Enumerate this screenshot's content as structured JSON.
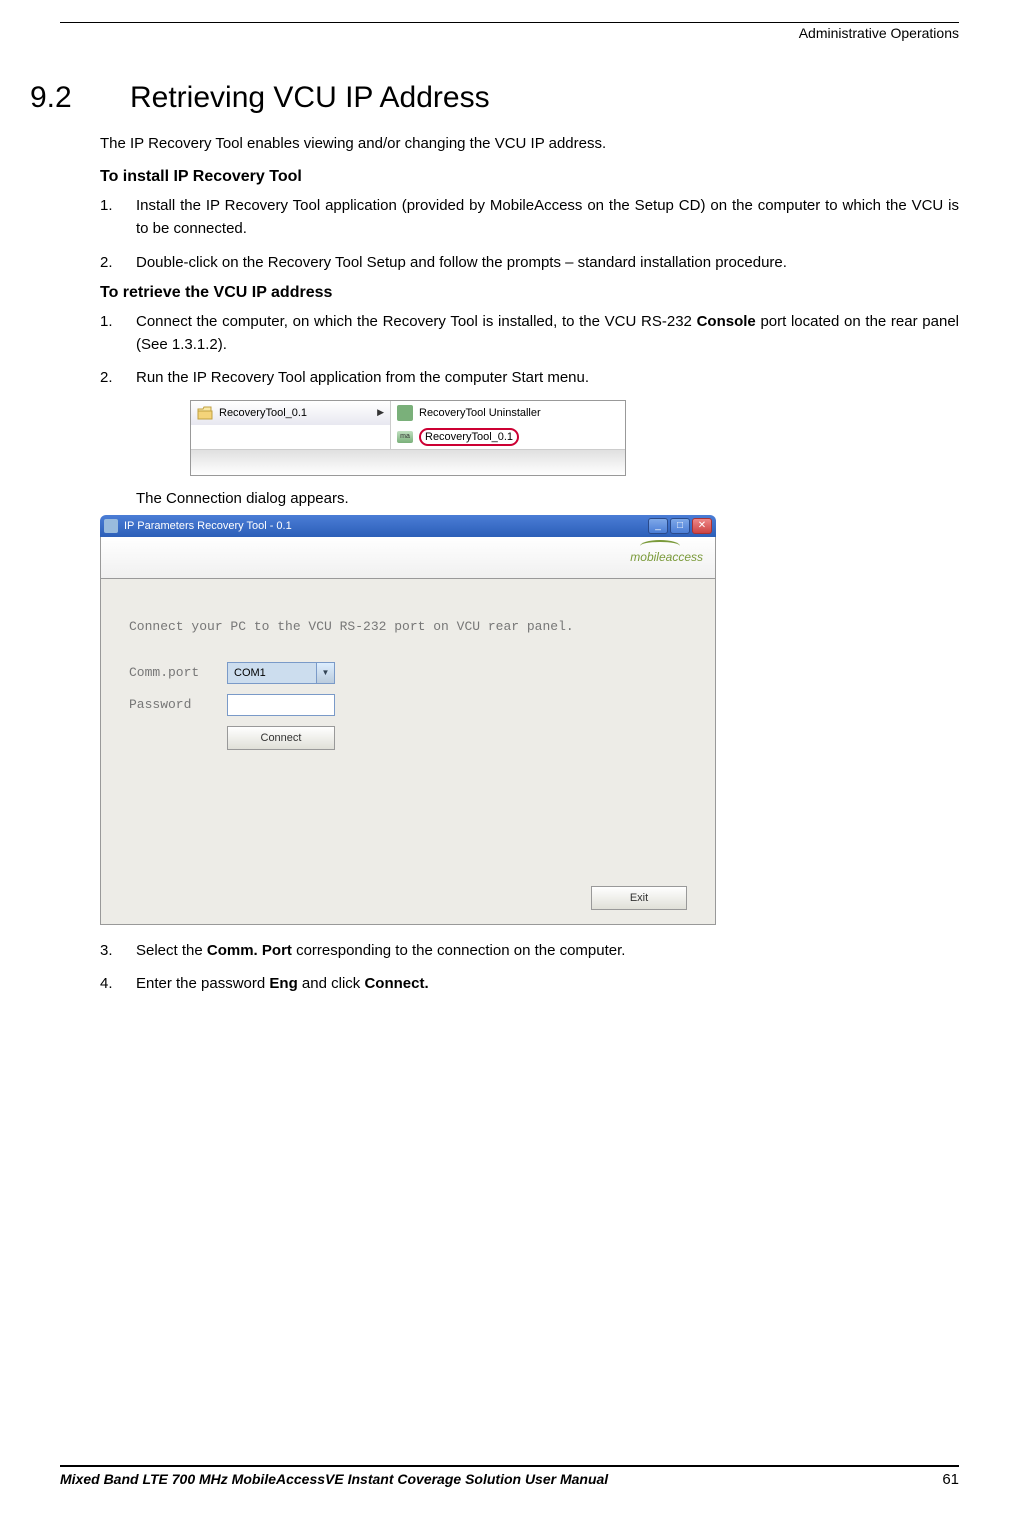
{
  "header": {
    "right": "Administrative Operations"
  },
  "section": {
    "number": "9.2",
    "title": "Retrieving VCU IP Address"
  },
  "intro": "The IP Recovery Tool enables viewing and/or changing the VCU IP address.",
  "install": {
    "heading": "To install IP Recovery Tool",
    "steps": {
      "s1_num": "1.",
      "s1": "Install the IP Recovery Tool application (provided by MobileAccess on the Setup CD) on the computer to which the VCU is to be connected.",
      "s2_num": "2.",
      "s2": "Double-click on the Recovery Tool Setup and follow the prompts – standard installation procedure."
    }
  },
  "retrieve": {
    "heading": "To retrieve the VCU IP address",
    "s1_num": "1.",
    "s1_a": "Connect the computer, on which the Recovery Tool is installed, to the VCU RS-232 ",
    "s1_b": "Console",
    "s1_c": " port located on the rear panel (See ",
    "s1_d": "1.3.1.2",
    "s1_e": ").",
    "s2_num": "2.",
    "s2": "Run the IP Recovery Tool application from the computer Start menu.",
    "after_fig1": "The Connection dialog appears.",
    "s3_num": "3.",
    "s3_a": "Select the ",
    "s3_b": "Comm. Port",
    "s3_c": " corresponding to the connection on the computer.",
    "s4_num": "4.",
    "s4_a": "Enter the password ",
    "s4_b": "Eng",
    "s4_c": " and click ",
    "s4_d": "Connect."
  },
  "fig1": {
    "folder_label": "RecoveryTool_0.1",
    "uninstaller": "RecoveryTool Uninstaller",
    "app": "RecoveryTool_0.1",
    "ma": "ma"
  },
  "fig2": {
    "title": "IP Parameters Recovery Tool - 0.1",
    "logo": "mobileaccess",
    "msg": "Connect your PC to the VCU RS-232 port on VCU rear panel.",
    "comm_label": "Comm.port",
    "comm_value": "COM1",
    "pwd_label": "Password",
    "connect": "Connect",
    "exit": "Exit"
  },
  "footer": {
    "title": "Mixed Band LTE 700 MHz MobileAccessVE Instant Coverage Solution User Manual",
    "page": "61"
  }
}
